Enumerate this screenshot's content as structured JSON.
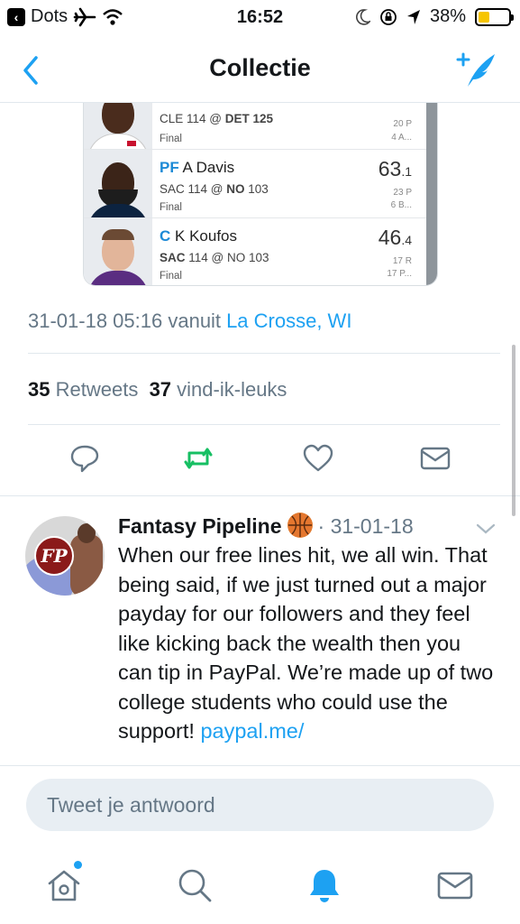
{
  "status_bar": {
    "carrier": "Dots",
    "time": "16:52",
    "battery_percent": "38%",
    "battery_level": 0.38,
    "battery_color": "#f6c500"
  },
  "nav": {
    "title": "Collectie",
    "back_icon": "chevron-left-icon",
    "compose_icon": "compose-tweet-icon"
  },
  "players": [
    {
      "pos": "",
      "name": "",
      "game": "CLE 114 @ DET 125",
      "game_bold_part": "DET 125",
      "status": "Final",
      "score_main": "",
      "score_dec": "",
      "stat1": "20 P",
      "stat2": "4 A..."
    },
    {
      "pos": "PF",
      "name": "A Davis",
      "game_prefix": "SAC 114 @ ",
      "game_bold": "NO",
      "game_suffix": " 103",
      "status": "Final",
      "score_main": "63",
      "score_dec": ".1",
      "stat1": "23 P",
      "stat2": "6 B..."
    },
    {
      "pos": "C",
      "name": "K Koufos",
      "game_bold": "SAC",
      "game_suffix": " 114 @ NO 103",
      "status": "Final",
      "score_main": "46",
      "score_dec": ".4",
      "stat1": "17 R",
      "stat2": "17 P..."
    }
  ],
  "tweet_meta": {
    "timestamp": "31-01-18 05:16 vanuit",
    "location": "La Crosse, WI",
    "retweets_count": "35",
    "retweets_label": "Retweets",
    "likes_count": "37",
    "likes_label": "vind-ik-leuks"
  },
  "actions": {
    "reply_icon": "reply-icon",
    "retweet_icon": "retweet-icon",
    "like_icon": "heart-icon",
    "dm_icon": "envelope-icon",
    "retweet_color": "#17bf63"
  },
  "reply_tweet": {
    "author": "Fantasy Pipeline",
    "emoji": "basketball-icon",
    "date": "· 31-01-18",
    "avatar_text": "FP",
    "body": "When our free lines hit, we all win. That being said, if we just turned out a major payday for our followers and they feel like kicking back the wealth then you can tip in PayPal. We’re made up of two college students who could use the support! ",
    "link": "paypal.me/"
  },
  "reply_box": {
    "placeholder": "Tweet je antwoord"
  },
  "tab_bar": {
    "home_icon": "home-icon",
    "search_icon": "search-icon",
    "notifications_icon": "bell-icon",
    "messages_icon": "envelope-icon",
    "active_color": "#1da1f2"
  },
  "colors": {
    "accent": "#1da1f2",
    "secondary_text": "#657786",
    "divider": "#e1e8ed"
  }
}
